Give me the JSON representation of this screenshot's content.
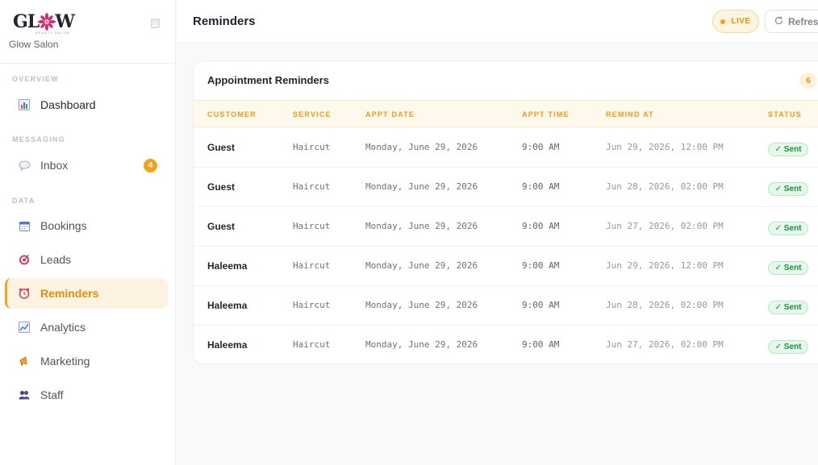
{
  "sidebar": {
    "logo_text_left": "GL",
    "logo_text_right": "W",
    "logo_sub": "BEAUTY SALON",
    "brand_name": "Glow Salon",
    "sections": {
      "overview": "OVERVIEW",
      "messaging": "MESSAGING",
      "data": "DATA"
    },
    "items": [
      {
        "label": "Dashboard",
        "icon": "bar-chart-icon"
      },
      {
        "label": "Inbox",
        "icon": "speech-bubble-icon",
        "badge": "4"
      },
      {
        "label": "Bookings",
        "icon": "calendar-icon"
      },
      {
        "label": "Leads",
        "icon": "target-icon"
      },
      {
        "label": "Reminders",
        "icon": "alarm-clock-icon",
        "active": true
      },
      {
        "label": "Analytics",
        "icon": "line-chart-icon"
      },
      {
        "label": "Marketing",
        "icon": "megaphone-icon"
      },
      {
        "label": "Staff",
        "icon": "people-icon"
      }
    ]
  },
  "header": {
    "title": "Reminders",
    "live_label": "LIVE",
    "refresh_label": "Refresh"
  },
  "card": {
    "title": "Appointment Reminders",
    "count": "6",
    "columns": [
      "CUSTOMER",
      "SERVICE",
      "APPT DATE",
      "APPT TIME",
      "REMIND AT",
      "STATUS"
    ],
    "rows": [
      {
        "customer": "Guest",
        "service": "Haircut",
        "date": "Monday, June 29, 2026",
        "time": "9:00 AM",
        "remind": "Jun 29, 2026, 12:00 PM",
        "status": "✓ Sent"
      },
      {
        "customer": "Guest",
        "service": "Haircut",
        "date": "Monday, June 29, 2026",
        "time": "9:00 AM",
        "remind": "Jun 28, 2026, 02:00 PM",
        "status": "✓ Sent"
      },
      {
        "customer": "Guest",
        "service": "Haircut",
        "date": "Monday, June 29, 2026",
        "time": "9:00 AM",
        "remind": "Jun 27, 2026, 02:00 PM",
        "status": "✓ Sent"
      },
      {
        "customer": "Haleema",
        "service": "Haircut",
        "date": "Monday, June 29, 2026",
        "time": "9:00 AM",
        "remind": "Jun 29, 2026, 12:00 PM",
        "status": "✓ Sent"
      },
      {
        "customer": "Haleema",
        "service": "Haircut",
        "date": "Monday, June 29, 2026",
        "time": "9:00 AM",
        "remind": "Jun 28, 2026, 02:00 PM",
        "status": "✓ Sent"
      },
      {
        "customer": "Haleema",
        "service": "Haircut",
        "date": "Monday, June 29, 2026",
        "time": "9:00 AM",
        "remind": "Jun 27, 2026, 02:00 PM",
        "status": "✓ Sent"
      }
    ]
  },
  "colors": {
    "accent": "#f2a516",
    "sent_green": "#1f8f3f",
    "logo_pink": "#d6287a"
  }
}
